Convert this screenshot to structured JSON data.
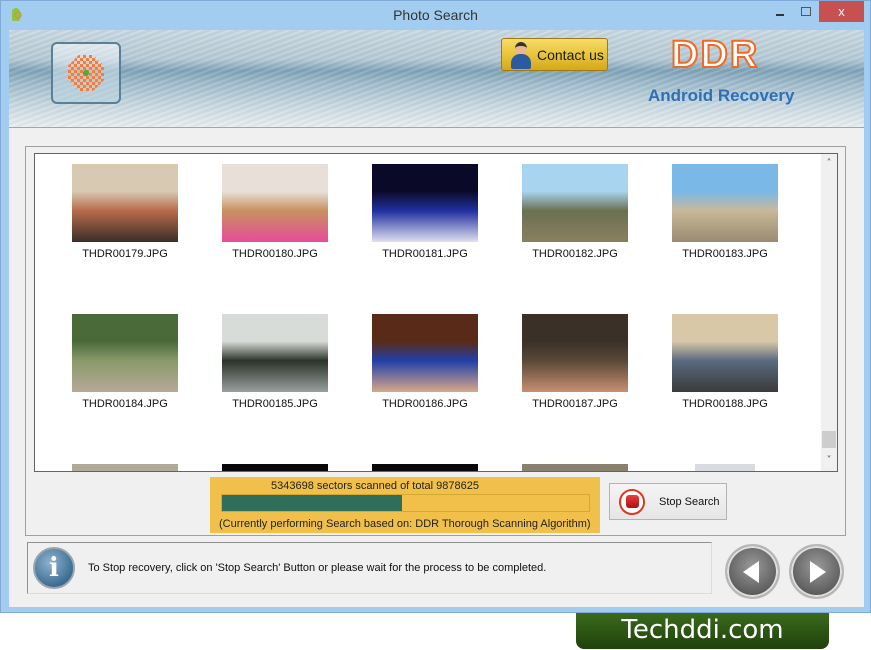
{
  "window": {
    "title": "Photo Search",
    "app_icon": "android-recovery-icon",
    "controls": {
      "minimize": "minimize-icon",
      "maximize": "maximize-icon",
      "close_label": "x"
    }
  },
  "banner": {
    "logo_icon": "checkered-logo-icon",
    "contact_label": "Contact us",
    "contact_icon": "person-icon",
    "brand": "DDR",
    "product": "Android Recovery"
  },
  "photos": [
    {
      "name": "THDR00179.JPG",
      "colors": [
        "#d8c9b2",
        "#b86a4a",
        "#3a2e28"
      ]
    },
    {
      "name": "THDR00180.JPG",
      "colors": [
        "#e8e0d8",
        "#c89060",
        "#e84c9a"
      ]
    },
    {
      "name": "THDR00181.JPG",
      "colors": [
        "#0a0a28",
        "#2030a0",
        "#e0e0f0"
      ]
    },
    {
      "name": "THDR00182.JPG",
      "colors": [
        "#a8d4f0",
        "#6a7050",
        "#8a8060"
      ]
    },
    {
      "name": "THDR00183.JPG",
      "colors": [
        "#7ab8e8",
        "#c8b898",
        "#9a8a70"
      ]
    },
    {
      "name": "THDR00184.JPG",
      "colors": [
        "#4a6a3a",
        "#8a9a6a",
        "#b8a898"
      ]
    },
    {
      "name": "THDR00185.JPG",
      "colors": [
        "#d8dcd8",
        "#2a3428",
        "#9aa0a0"
      ]
    },
    {
      "name": "THDR00186.JPG",
      "colors": [
        "#5a2a18",
        "#2040a8",
        "#d8a888"
      ]
    },
    {
      "name": "THDR00187.JPG",
      "colors": [
        "#3a3028",
        "#5a4838",
        "#c89070"
      ]
    },
    {
      "name": "THDR00188.JPG",
      "colors": [
        "#d8c8a8",
        "#5a6a80",
        "#3a3a3a"
      ]
    }
  ],
  "partial_row_colors": [
    "#b0a898",
    "#080808",
    "#080808",
    "#8a8070",
    "#d8dce0"
  ],
  "scan": {
    "sectors_scanned": 5343698,
    "sectors_total": 9878625,
    "status_line": "5343698 sectors scanned of total 9878625",
    "progress_fraction": 0.49,
    "algorithm_line": "(Currently performing Search based on:  DDR Thorough Scanning Algorithm)",
    "progress_color": "#2f6f5a"
  },
  "stop_button": {
    "label": "Stop Search",
    "icon": "stop-icon"
  },
  "status": {
    "icon": "info-icon",
    "message": "To Stop recovery, click on 'Stop Search' Button or please wait for the process to be completed."
  },
  "nav": {
    "back_icon": "back-arrow-icon",
    "next_icon": "next-arrow-icon"
  },
  "watermark": "Techddi.com"
}
